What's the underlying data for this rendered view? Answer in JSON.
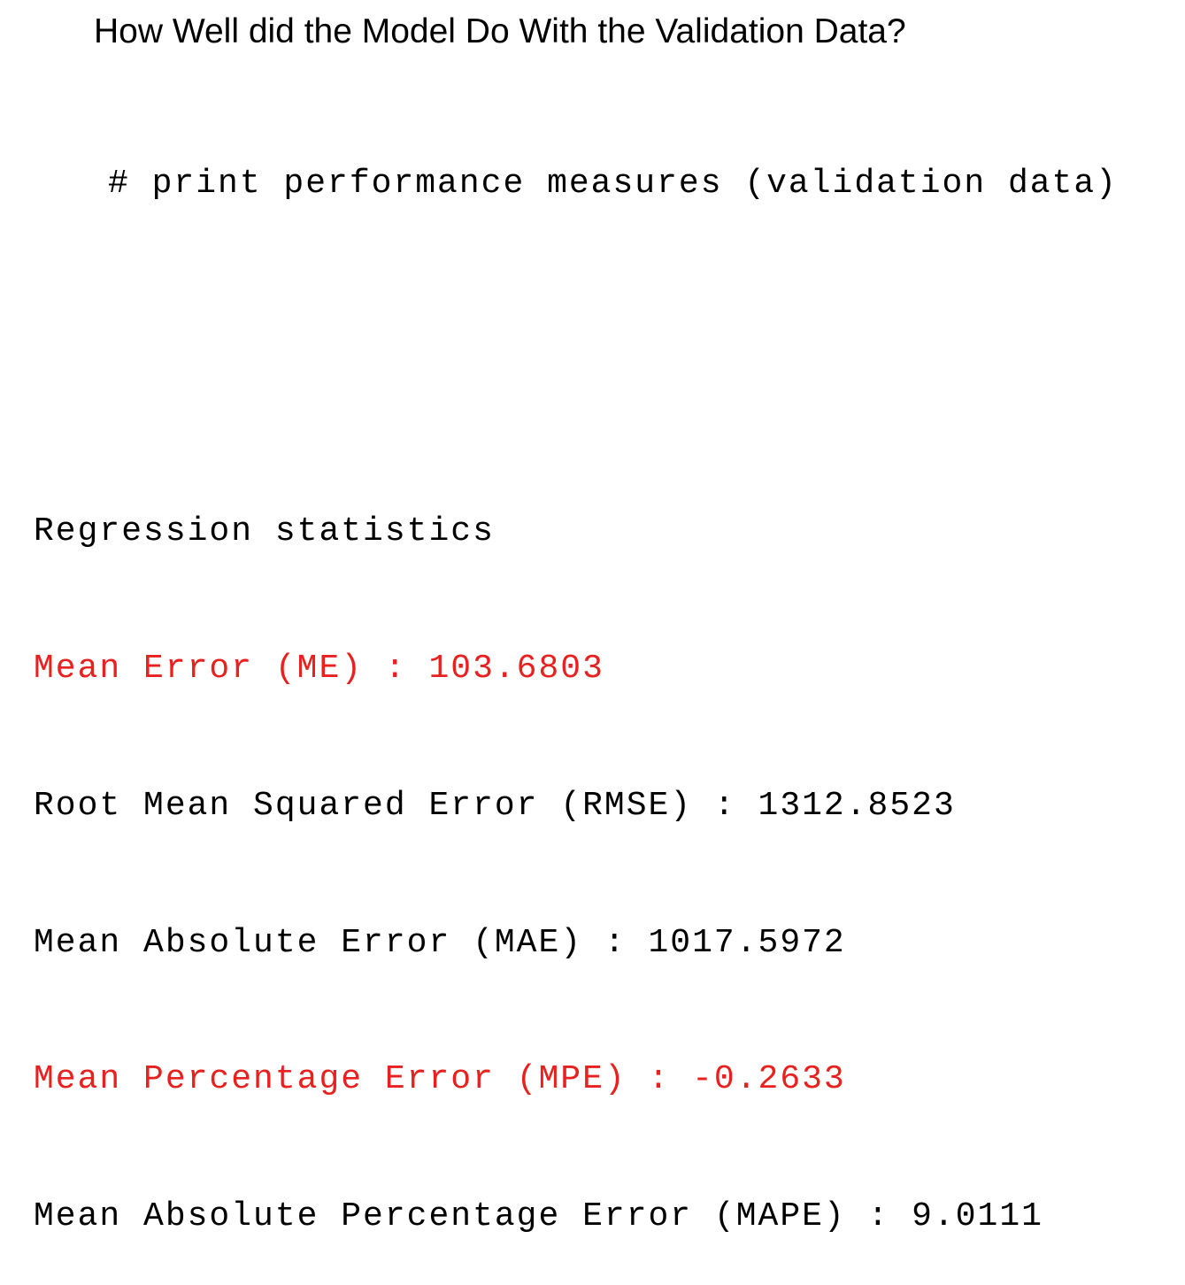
{
  "title": "How Well did the Model Do With the Validation Data?",
  "comment": "# print performance measures (validation data)",
  "output": {
    "heading": "Regression statistics",
    "lines": [
      {
        "text": "Mean Error (ME) : 103.6803",
        "color": "#e8201e"
      },
      {
        "text": "Root Mean Squared Error (RMSE) : 1312.8523",
        "color": "#000000"
      },
      {
        "text": "Mean Absolute Error (MAE) : 1017.5972",
        "color": "#000000"
      },
      {
        "text": "Mean Percentage Error (MPE) : -0.2633",
        "color": "#e8201e"
      },
      {
        "text": "Mean Absolute Percentage Error (MAPE) : 9.0111",
        "color": "#000000"
      }
    ]
  }
}
